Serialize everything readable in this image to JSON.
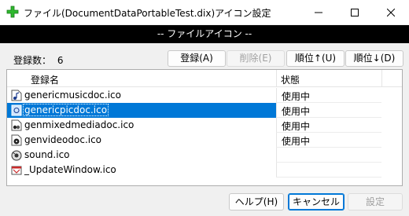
{
  "window": {
    "title": "ファイル(DocumentDataPortableTest.dix)アイコン設定"
  },
  "header": {
    "label": "-- ファイルアイコン --"
  },
  "toolbar": {
    "count_label": "登録数：",
    "count_value": "6",
    "register_label": "登録(A)",
    "delete_label": "削除(E)",
    "move_up_label": "順位↑(U)",
    "move_down_label": "順位↓(D)"
  },
  "list": {
    "columns": [
      "登録名",
      "状態"
    ],
    "rows": [
      {
        "name": "genericmusicdoc.ico",
        "status": "使用中",
        "icon": "music-doc-icon"
      },
      {
        "name": "genericpicdoc.ico",
        "status": "使用中",
        "icon": "picture-doc-icon",
        "selected": true
      },
      {
        "name": "genmixedmediadoc.ico",
        "status": "使用中",
        "icon": "mixed-media-icon"
      },
      {
        "name": "genvideodoc.ico",
        "status": "使用中",
        "icon": "video-doc-icon"
      },
      {
        "name": "sound.ico",
        "status": "",
        "icon": "sound-icon"
      },
      {
        "name": "_UpdateWindow.ico",
        "status": "",
        "icon": "update-window-icon"
      }
    ]
  },
  "footer": {
    "help_label": "ヘルプ(H)",
    "cancel_label": "キャンセル",
    "apply_label": "設定"
  },
  "colors": {
    "selection": "#0078d7",
    "header_bar": "#000000",
    "app_icon": "#2eb82e"
  }
}
